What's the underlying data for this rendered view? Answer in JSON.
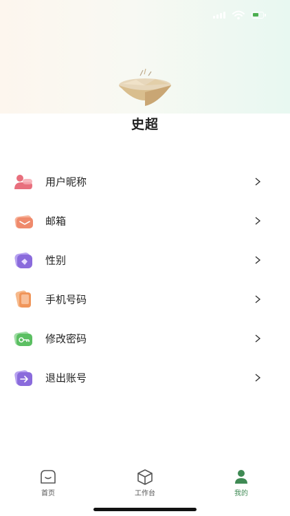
{
  "profile": {
    "name": "史超"
  },
  "menu": [
    {
      "label": "用户昵称",
      "icon": "user-nickname-icon",
      "color": "#e86f7d"
    },
    {
      "label": "邮箱",
      "icon": "mail-icon",
      "color": "#ef8a6c"
    },
    {
      "label": "性别",
      "icon": "gender-icon",
      "color": "#8a6bdc"
    },
    {
      "label": "手机号码",
      "icon": "phone-icon",
      "color": "#f0955a"
    },
    {
      "label": "修改密码",
      "icon": "key-icon",
      "color": "#5bbf62"
    },
    {
      "label": "退出账号",
      "icon": "logout-icon",
      "color": "#8a6bdc"
    }
  ],
  "tabbar": {
    "home": "首页",
    "workbench": "工作台",
    "mine": "我的",
    "active_color": "#3f8a54",
    "inactive_color": "#555555"
  }
}
